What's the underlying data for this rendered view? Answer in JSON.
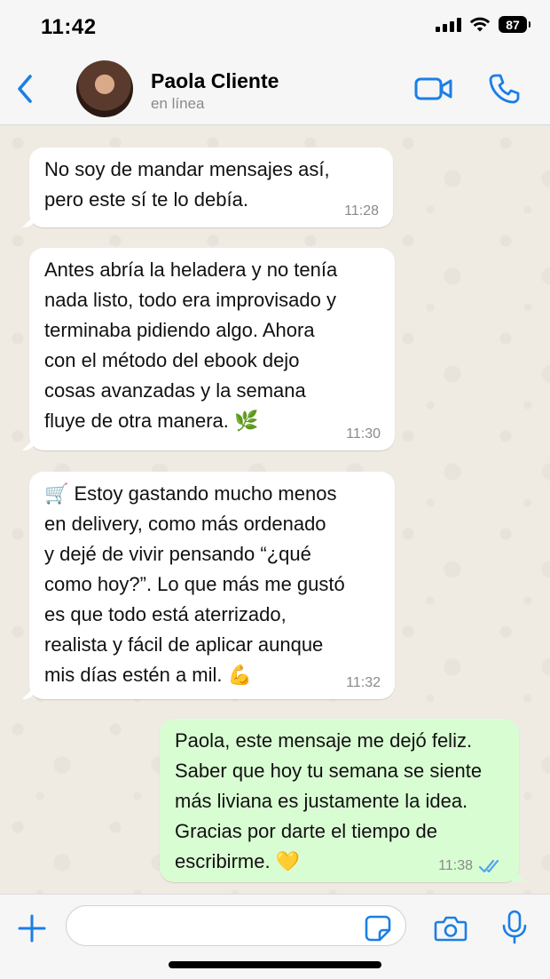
{
  "status_bar": {
    "time": "11:42",
    "battery": "87"
  },
  "header": {
    "contact_name": "Paola Cliente",
    "status": "en línea"
  },
  "messages": [
    {
      "direction": "incoming",
      "lines": [
        "No soy de mandar mensajes así,",
        "pero este sí te lo debía."
      ],
      "time": "11:28"
    },
    {
      "direction": "incoming",
      "lines": [
        "Antes abría la heladera y no tenía",
        "nada listo, todo era improvisado y",
        "terminaba pidiendo algo. Ahora",
        "con el método del ebook dejo",
        "cosas avanzadas y la semana",
        "fluye de otra manera. 🌿"
      ],
      "time": "11:30"
    },
    {
      "direction": "incoming",
      "lines": [
        "🛒 Estoy gastando mucho menos",
        "en delivery, como más ordenado",
        "y dejé de vivir pensando “¿qué",
        "como hoy?”. Lo que más me gustó",
        "es que todo está aterrizado,",
        "realista y fácil de aplicar aunque",
        "mis días estén a mil. 💪"
      ],
      "time": "11:32"
    },
    {
      "direction": "outgoing",
      "lines": [
        "Paola, este mensaje me dejó feliz.",
        "Saber que hoy tu semana se siente",
        "más liviana es justamente la idea.",
        "Gracias por darte el tiempo de",
        "escribirme. 💛"
      ],
      "time": "11:38",
      "read": true
    }
  ],
  "composer": {
    "value": "",
    "placeholder": ""
  },
  "icons": {
    "back": "chevron-left-icon",
    "video": "video-camera-icon",
    "call": "phone-icon",
    "attach": "plus-icon",
    "sticker": "sticker-icon",
    "camera": "camera-icon",
    "mic": "microphone-icon",
    "read_receipt": "double-check-icon"
  },
  "colors": {
    "accent": "#1a7ee6",
    "incoming_bubble": "#ffffff",
    "outgoing_bubble": "#d9fdd3",
    "chat_background": "#efeae2",
    "read_receipt": "#53a6e8"
  }
}
